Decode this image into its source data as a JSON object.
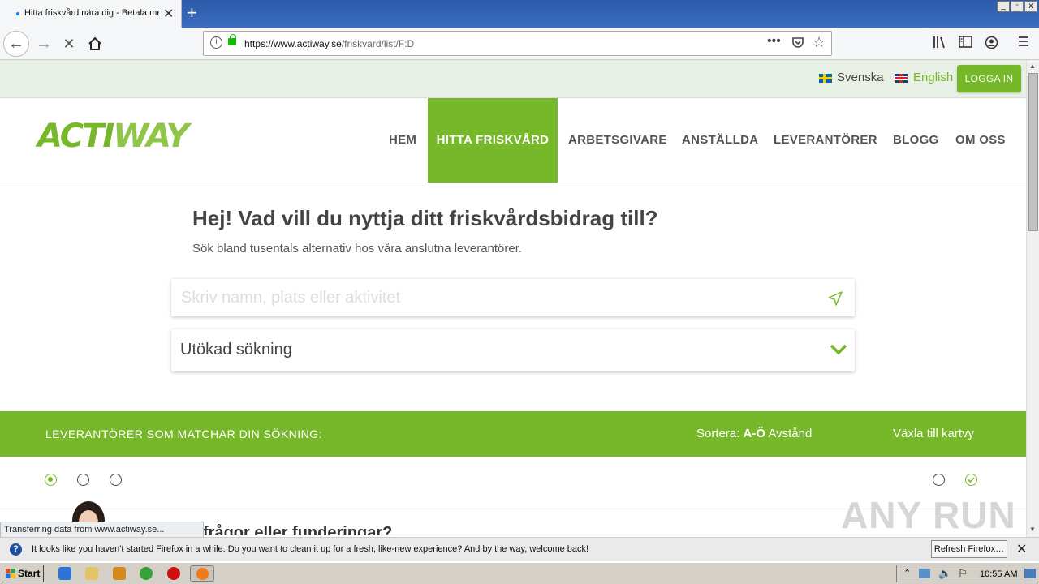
{
  "browser": {
    "tab_title": "Hitta friskvård nära dig - Betala me",
    "new_tab": "+",
    "url_host": "https://www.actiway.se",
    "url_path": "/friskvard/list/F:D",
    "window_controls": [
      "_",
      "▫",
      "x"
    ],
    "status_text": "Transferring data from www.actiway.se..."
  },
  "site": {
    "lang_sv": "Svenska",
    "lang_en": "English",
    "login": "LOGGA IN",
    "logo_ac": "ACTI",
    "logo_way": "WAY",
    "menu": [
      "HEM",
      "HITTA FRISKVÅRD",
      "ARBETSGIVARE",
      "ANSTÄLLDA",
      "LEVERANTÖRER",
      "BLOGG",
      "OM OSS"
    ],
    "active_menu": "HITTA FRISKVÅRD",
    "hero_title": "Hej! Vad vill du nyttja ditt friskvårdsbidrag till?",
    "hero_subtitle": "Sök bland tusentals alternativ hos våra anslutna leverantörer.",
    "search_placeholder": "Skriv namn, plats eller aktivitet",
    "advanced_search": "Utökad sökning",
    "results_label": "LEVERANTÖRER SOM MATCHAR DIN SÖKNING:",
    "sort_label": "Sortera:",
    "sort_az": "A-Ö",
    "sort_distance": "Avstånd",
    "map_toggle": "Växla till kartvy",
    "faq_text": "frågor eller funderingar?",
    "accent_color": "#76b82a"
  },
  "notification": {
    "message": "It looks like you haven't started Firefox in a while. Do you want to clean it up for a fresh, like-new experience? And by the way, welcome back!",
    "button": "Refresh Firefox…",
    "close": "✕"
  },
  "taskbar": {
    "start": "Start",
    "clock": "10:55 AM"
  },
  "watermark": "ANY RUN"
}
